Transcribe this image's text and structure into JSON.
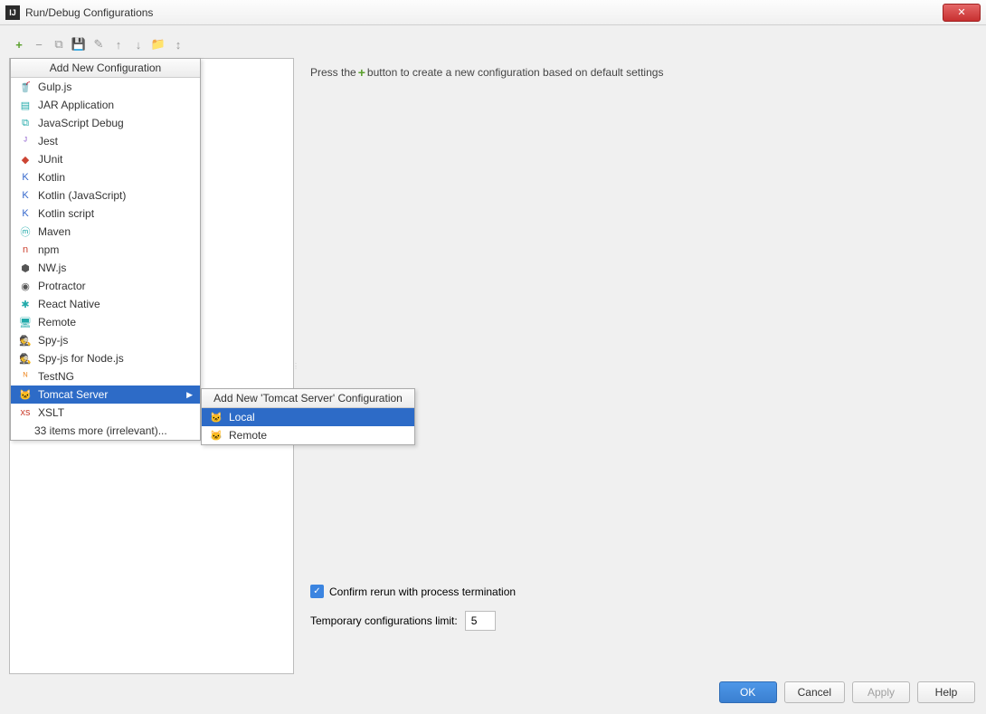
{
  "window": {
    "title": "Run/Debug Configurations"
  },
  "toolbar": {
    "add_tip": "+",
    "remove_tip": "−",
    "copy_tip": "⧉",
    "save_tip": "💾",
    "edit_tip": "✎",
    "up_tip": "↑",
    "down_tip": "↓",
    "folder_tip": "📁",
    "sort_tip": "↕"
  },
  "popup": {
    "header": "Add New Configuration",
    "items": [
      {
        "label": "Gulp.js",
        "icon": "🥤",
        "cls": "ic-red"
      },
      {
        "label": "JAR Application",
        "icon": "▤",
        "cls": "ic-teal"
      },
      {
        "label": "JavaScript Debug",
        "icon": "⧉",
        "cls": "ic-teal"
      },
      {
        "label": "Jest",
        "icon": "ᴶ",
        "cls": "ic-purple"
      },
      {
        "label": "JUnit",
        "icon": "◆",
        "cls": "ic-red"
      },
      {
        "label": "Kotlin",
        "icon": "K",
        "cls": "ic-blue"
      },
      {
        "label": "Kotlin (JavaScript)",
        "icon": "K",
        "cls": "ic-blue"
      },
      {
        "label": "Kotlin script",
        "icon": "K",
        "cls": "ic-blue"
      },
      {
        "label": "Maven",
        "icon": "ⓜ",
        "cls": "ic-teal"
      },
      {
        "label": "npm",
        "icon": "n",
        "cls": "ic-red"
      },
      {
        "label": "NW.js",
        "icon": "⬢",
        "cls": "ic-dark"
      },
      {
        "label": "Protractor",
        "icon": "◉",
        "cls": "ic-dark"
      },
      {
        "label": "React Native",
        "icon": "✱",
        "cls": "ic-teal"
      },
      {
        "label": "Remote",
        "icon": "🖥",
        "cls": "ic-teal"
      },
      {
        "label": "Spy-js",
        "icon": "🕵",
        "cls": "ic-yellow"
      },
      {
        "label": "Spy-js for Node.js",
        "icon": "🕵",
        "cls": "ic-green"
      },
      {
        "label": "TestNG",
        "icon": "ᴺ",
        "cls": "ic-orange"
      },
      {
        "label": "Tomcat Server",
        "icon": "🐱",
        "cls": "ic-orange",
        "selected": true,
        "has_sub": true
      },
      {
        "label": "XSLT",
        "icon": "xs",
        "cls": "ic-red"
      }
    ],
    "more": "33 items more (irrelevant)..."
  },
  "submenu": {
    "header": "Add New 'Tomcat Server' Configuration",
    "items": [
      {
        "label": "Local",
        "icon": "🐱",
        "selected": true
      },
      {
        "label": "Remote",
        "icon": "🐱",
        "selected": false
      }
    ]
  },
  "right": {
    "press1": "Press the",
    "press2": "button to create a new configuration based on default settings",
    "confirm_label": "Confirm rerun with process termination",
    "limit_label": "Temporary configurations limit:",
    "limit_value": "5"
  },
  "buttons": {
    "ok": "OK",
    "cancel": "Cancel",
    "apply": "Apply",
    "help": "Help"
  }
}
